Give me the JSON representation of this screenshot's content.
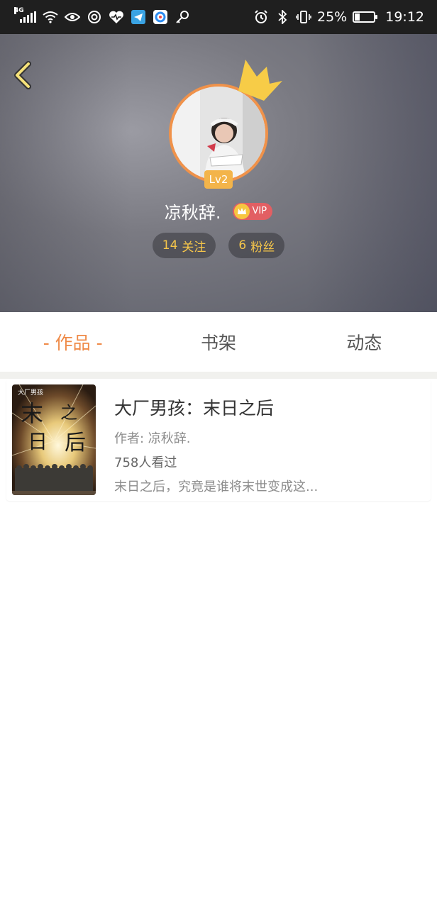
{
  "status": {
    "network": "4G",
    "battery_text": "25%",
    "battery_level": 0.25,
    "time": "19:12",
    "left_icons": [
      "signal-icon",
      "wifi-icon",
      "eye-icon",
      "swirl-icon",
      "heart-pulse-icon",
      "telegram-icon",
      "browser-icon",
      "key-icon"
    ],
    "right_icons": [
      "alarm-icon",
      "bluetooth-icon",
      "vibrate-icon",
      "battery-icon"
    ]
  },
  "profile": {
    "username": "凉秋辞.",
    "level": "Lv2",
    "vip_label": "VIP",
    "following_count": "14",
    "following_label": "关注",
    "fans_count": "6",
    "fans_label": "粉丝"
  },
  "tabs": [
    {
      "label": "- 作品 -",
      "active": true
    },
    {
      "label": "书架",
      "active": false
    },
    {
      "label": "动态",
      "active": false
    }
  ],
  "book": {
    "title": "大厂男孩：末日之后",
    "author": "作者: 凉秋辞.",
    "views": "758人看过",
    "summary": "末日之后，究竟是谁将末世变成这...",
    "cover_text": {
      "top": "大厂男孩",
      "big1": "末",
      "big2": "之",
      "big3": "日",
      "big4": "后"
    }
  },
  "colors": {
    "accent": "#ef8a47",
    "avatar_ring": "#f0924a",
    "stat_text": "#f6c64a",
    "vip_bg": "#e25f63",
    "crown": "#f7c640"
  }
}
